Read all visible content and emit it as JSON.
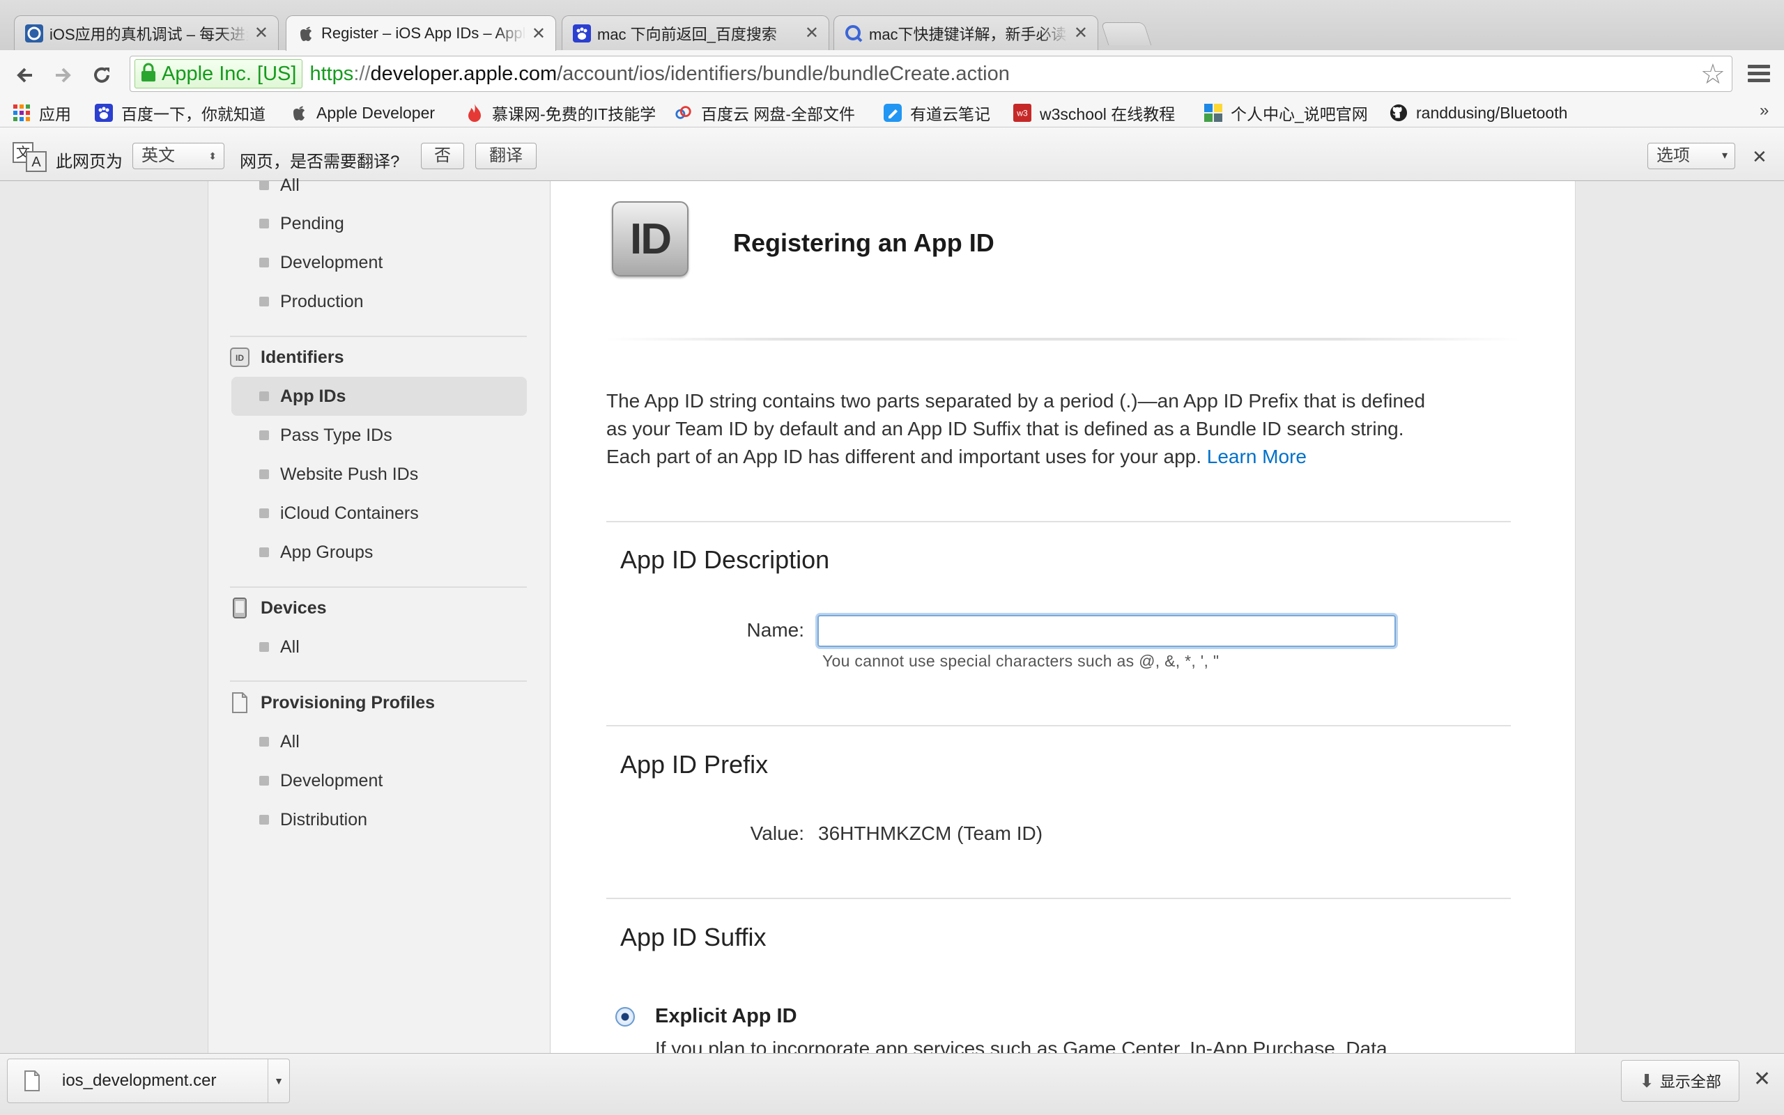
{
  "tabs": [
    {
      "title": "iOS应用的真机调试 – 每天进步",
      "favicon": "circle-c-icon",
      "active": false
    },
    {
      "title": "Register – iOS App IDs – Apple",
      "favicon": "apple-icon",
      "active": true
    },
    {
      "title": "mac 下向前返回_百度搜索",
      "favicon": "baidu-paw-icon",
      "active": false
    },
    {
      "title": "mac下快捷键详解，新手必读",
      "favicon": "search-q-icon",
      "active": false
    }
  ],
  "toolbar": {
    "ev_label": "Apple Inc. [US]",
    "url_scheme": "https",
    "url_sep": "://",
    "url_host": "developer.apple.com",
    "url_path": "/account/ios/identifiers/bundle/bundleCreate.action"
  },
  "bookmarks": [
    {
      "label": "应用",
      "icon": "apps-grid-icon"
    },
    {
      "label": "百度一下，你就知道",
      "icon": "baidu-paw-icon"
    },
    {
      "label": "Apple Developer",
      "icon": "apple-icon"
    },
    {
      "label": "慕课网-免费的IT技能学",
      "icon": "flame-icon"
    },
    {
      "label": "百度云 网盘-全部文件",
      "icon": "cloud-icon"
    },
    {
      "label": "有道云笔记",
      "icon": "note-icon"
    },
    {
      "label": "w3school 在线教程",
      "icon": "w3-icon"
    },
    {
      "label": "个人中心_说吧官网",
      "icon": "profile-icon"
    },
    {
      "label": "randdusing/Bluetooth",
      "icon": "github-icon"
    }
  ],
  "translate": {
    "prefix": "此网页为",
    "language": "英文",
    "question": "网页，是否需要翻译?",
    "no_button": "否",
    "translate_button": "翻译",
    "options": "选项"
  },
  "sidebar": {
    "certificates_items": [
      "All",
      "Pending",
      "Development",
      "Production"
    ],
    "identifiers_heading": "Identifiers",
    "identifiers_items": [
      "App IDs",
      "Pass Type IDs",
      "Website Push IDs",
      "iCloud Containers",
      "App Groups"
    ],
    "devices_heading": "Devices",
    "devices_items": [
      "All"
    ],
    "profiles_heading": "Provisioning Profiles",
    "profiles_items": [
      "All",
      "Development",
      "Distribution"
    ]
  },
  "main": {
    "icon_text": "ID",
    "title": "Registering an App ID",
    "intro_line1": "The App ID string contains two parts separated by a period (.)—an App ID Prefix that is defined",
    "intro_line2": "as your Team ID by default and an App ID Suffix that is defined as a Bundle ID search string.",
    "intro_line3": "Each part of an App ID has different and important uses for your app.",
    "learn_more": "Learn More",
    "desc_section": "App ID Description",
    "name_label": "Name:",
    "name_value": "",
    "name_hint": "You cannot use special characters such as @, &, *, ', \"",
    "prefix_section": "App ID Prefix",
    "value_label": "Value:",
    "prefix_value": "36HTHMKZCM (Team ID)",
    "suffix_section": "App ID Suffix",
    "explicit_label": "Explicit App ID",
    "explicit_desc": "If you plan to incorporate app services such as Game Center, In-App Purchase, Data"
  },
  "downloads": {
    "filename": "ios_development.cer",
    "show_all": "显示全部"
  },
  "colors": {
    "link": "#0070c9",
    "secure_green": "#159a1d",
    "focus_ring": "#7aa8d8"
  }
}
